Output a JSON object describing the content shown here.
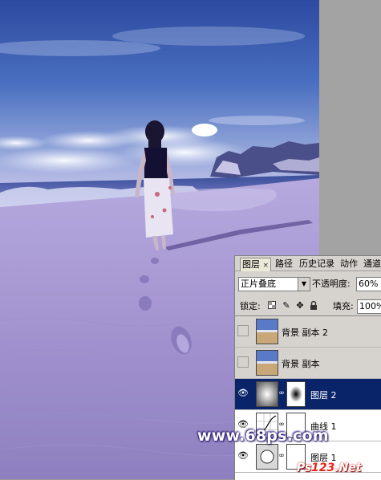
{
  "panel": {
    "tabs": [
      {
        "label": "图层",
        "active": true,
        "close": "×"
      },
      {
        "label": "路径"
      },
      {
        "label": "历史记录"
      },
      {
        "label": "动作"
      },
      {
        "label": "通道"
      }
    ],
    "blend_mode": "正片叠底",
    "opacity_label": "不透明度:",
    "opacity_value": "60%",
    "lock_label": "锁定:",
    "fill_label": "填充:",
    "fill_value": "100%",
    "layers": [
      {
        "name": "背景 副本 2",
        "visible": false,
        "selected": false,
        "thumb": "photo"
      },
      {
        "name": "背景 副本",
        "visible": false,
        "selected": false,
        "thumb": "photo"
      },
      {
        "name": "图层 2",
        "visible": true,
        "selected": true,
        "thumb": "gradient",
        "mask": true
      },
      {
        "name": "曲线 1",
        "visible": true,
        "selected": false,
        "thumb": "curves",
        "mask": true
      },
      {
        "name": "图层 1",
        "visible": true,
        "selected": false,
        "thumb": "circle",
        "mask": true
      }
    ]
  },
  "watermarks": {
    "site1": "www.68ps.com",
    "site2_prefix": "Ps",
    "site2_number": "123",
    "site2_suffix": ".Net"
  },
  "colors": {
    "selected_row": "#0a246a",
    "panel_bg": "#d6d3ce",
    "sky_top": "#3a56a8",
    "sand": "#b3a8d8"
  }
}
